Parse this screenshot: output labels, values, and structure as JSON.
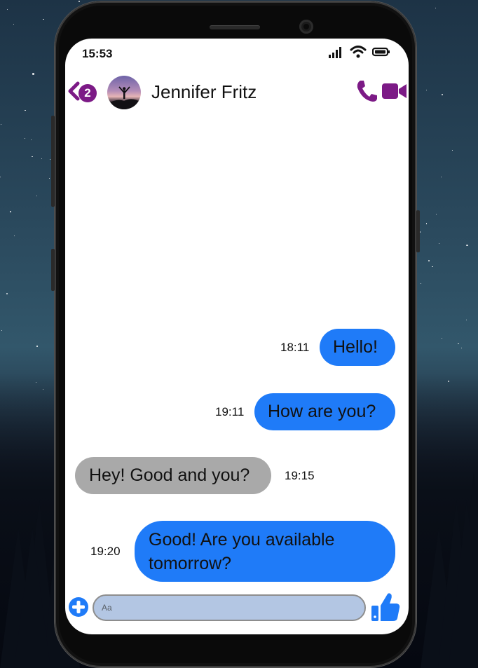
{
  "status_bar": {
    "time": "15:53"
  },
  "header": {
    "unread_count": "2",
    "contact_name": "Jennifer Fritz"
  },
  "messages": [
    {
      "direction": "outgoing",
      "text": "Hello!",
      "time": "18:11"
    },
    {
      "direction": "outgoing",
      "text": "How are you?",
      "time": "19:11"
    },
    {
      "direction": "incoming",
      "text": "Hey! Good and you?",
      "time": "19:15"
    },
    {
      "direction": "outgoing",
      "text": "Good! Are you available tomorrow?",
      "time": "19:20"
    }
  ],
  "composer": {
    "placeholder": "Aa"
  },
  "colors": {
    "accent": "#7c1a86",
    "outgoing_bubble": "#1f7bf8",
    "incoming_bubble": "#a9a9a9",
    "input_background": "#b3c6e3"
  },
  "icons": [
    "back-chevron-icon",
    "phone-call-icon",
    "video-call-icon",
    "plus-icon",
    "thumbs-up-icon",
    "signal-icon",
    "wifi-icon",
    "battery-icon"
  ]
}
